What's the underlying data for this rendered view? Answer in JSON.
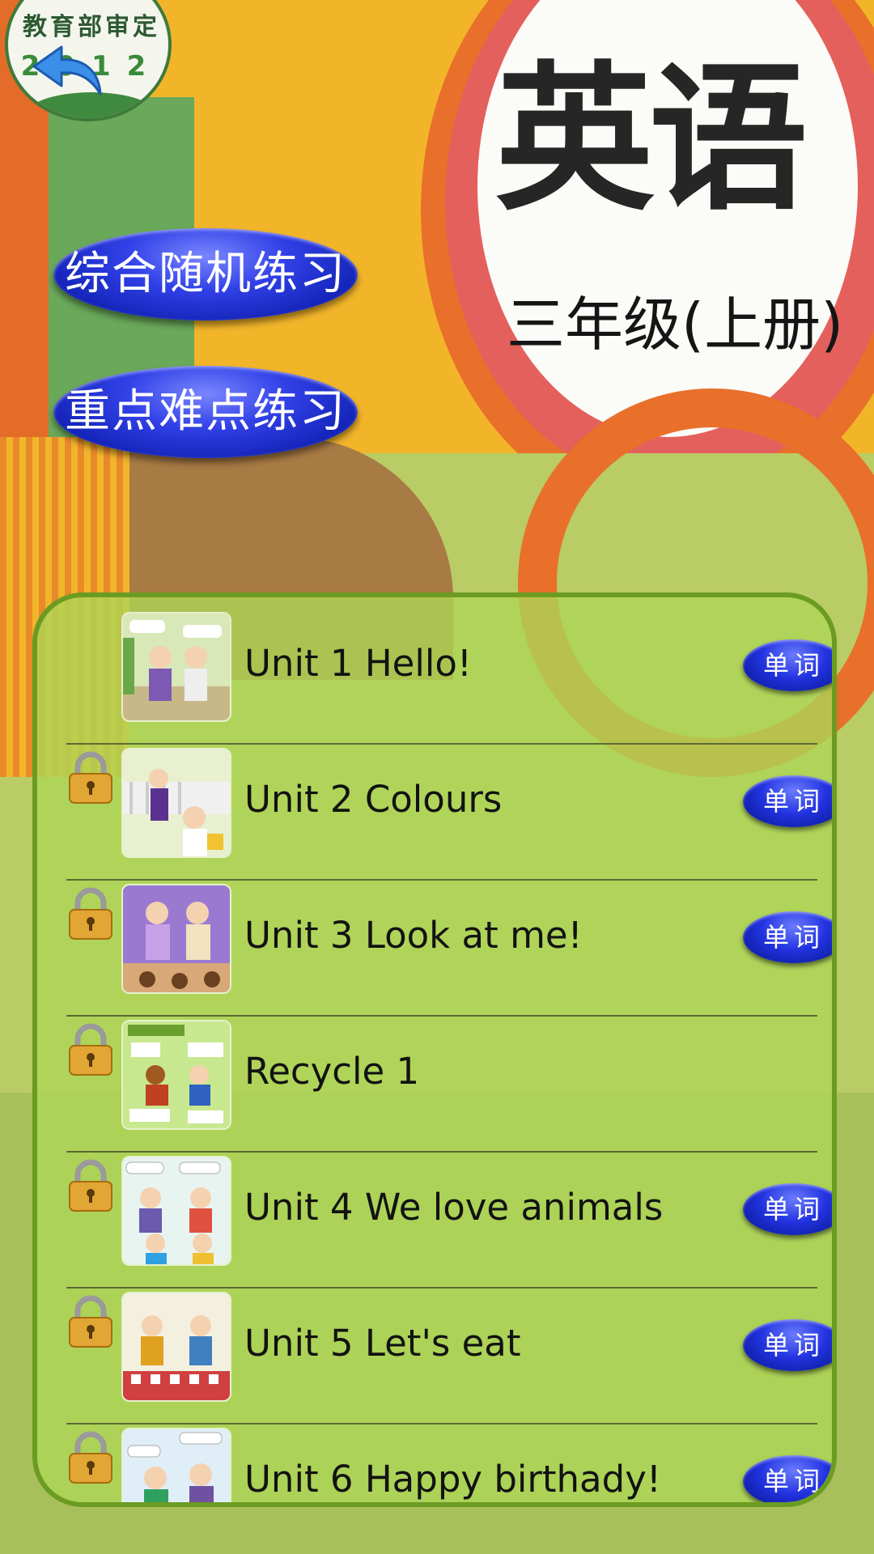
{
  "seal": {
    "text": "教育部审定",
    "year": "2012"
  },
  "title": {
    "main": "英语",
    "sub": "三年级(上册)"
  },
  "buttons": {
    "random_practice": "综合随机练习",
    "key_practice": "重点难点练习"
  },
  "word_label": "单词",
  "colors": {
    "panel_border": "#6c9b22",
    "button_blue": "#2233e0",
    "cover_yellow": "#f2b52a"
  },
  "units": [
    {
      "label": "Unit 1 Hello!",
      "locked": false,
      "has_words": true
    },
    {
      "label": "Unit 2 Colours",
      "locked": true,
      "has_words": true
    },
    {
      "label": "Unit 3 Look at me!",
      "locked": true,
      "has_words": true
    },
    {
      "label": "Recycle 1",
      "locked": true,
      "has_words": false
    },
    {
      "label": "Unit 4 We love animals",
      "locked": true,
      "has_words": true
    },
    {
      "label": "Unit 5 Let's eat",
      "locked": true,
      "has_words": true
    },
    {
      "label": "Unit 6 Happy birthady!",
      "locked": true,
      "has_words": true
    }
  ]
}
